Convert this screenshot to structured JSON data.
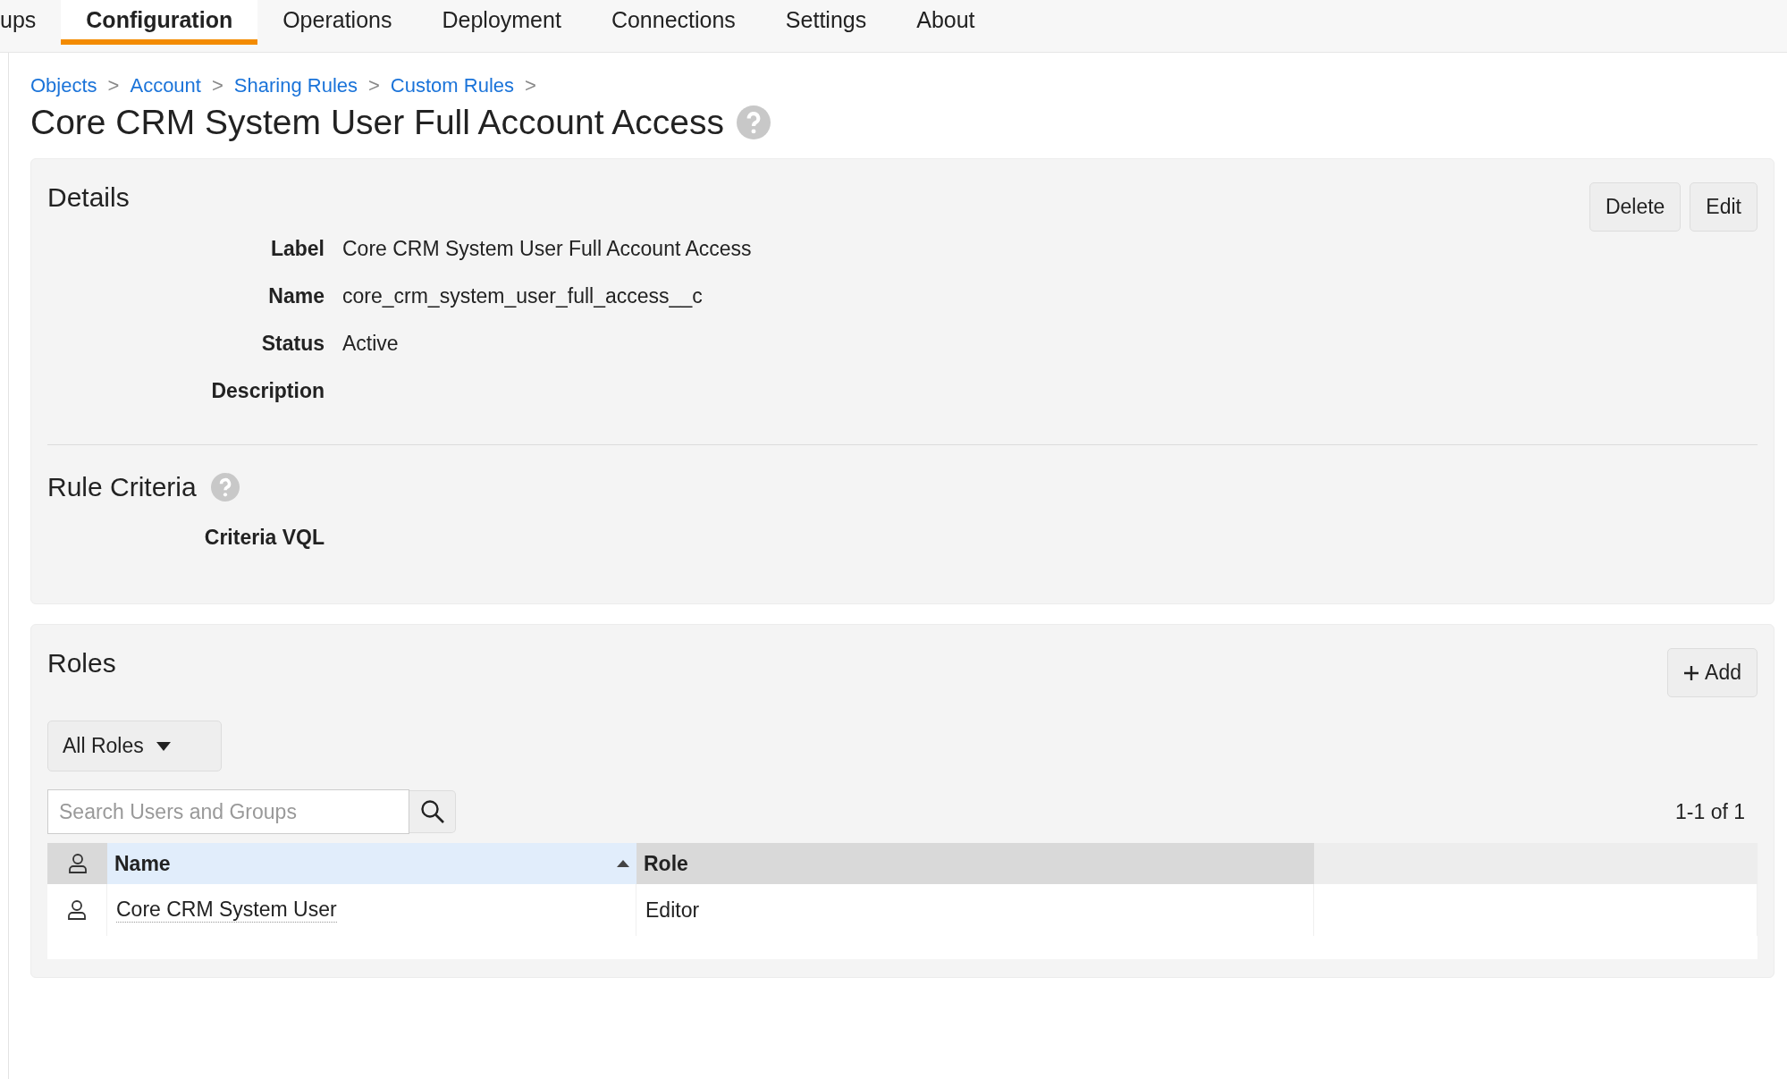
{
  "tabs": [
    {
      "label": "ups",
      "selected": false
    },
    {
      "label": "Configuration",
      "selected": true
    },
    {
      "label": "Operations",
      "selected": false
    },
    {
      "label": "Deployment",
      "selected": false
    },
    {
      "label": "Connections",
      "selected": false
    },
    {
      "label": "Settings",
      "selected": false
    },
    {
      "label": "About",
      "selected": false
    }
  ],
  "breadcrumb": {
    "separator": ">",
    "items": [
      "Objects",
      "Account",
      "Sharing Rules",
      "Custom Rules"
    ]
  },
  "title": "Core CRM System User Full Account Access",
  "details": {
    "heading": "Details",
    "buttons": [
      "Delete",
      "Edit"
    ],
    "fields": [
      {
        "label": "Label",
        "value": "Core CRM System User Full Account Access"
      },
      {
        "label": "Name",
        "value": "core_crm_system_user_full_access__c"
      },
      {
        "label": "Status",
        "value": "Active"
      },
      {
        "label": "Description"
      }
    ]
  },
  "rule_criteria": {
    "heading": "Rule Criteria",
    "fields": [
      {
        "label": "Criteria VQL"
      }
    ]
  },
  "roles": {
    "heading": "Roles",
    "add_button": "Add",
    "filter": "All Roles",
    "search": {
      "placeholder": "Search Users and Groups"
    },
    "count": "1-1 of 1",
    "columns": [
      {
        "label": "Name",
        "sorted": true
      },
      {
        "label": "Role",
        "sorted": false
      }
    ],
    "rows": [
      {
        "name": "Core CRM System User",
        "role": "Editor"
      }
    ]
  }
}
